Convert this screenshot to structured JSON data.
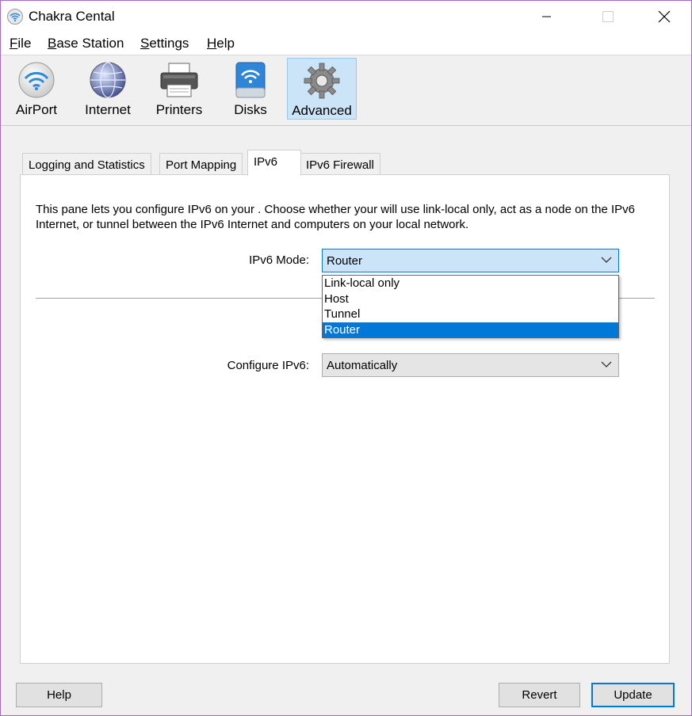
{
  "window": {
    "title": "Chakra Cental"
  },
  "menu": [
    {
      "mnemonic": "F",
      "rest": "ile"
    },
    {
      "mnemonic": "B",
      "rest": "ase Station"
    },
    {
      "mnemonic": "S",
      "rest": "ettings"
    },
    {
      "mnemonic": "H",
      "rest": "elp"
    }
  ],
  "toolbar": [
    {
      "label": "AirPort",
      "icon": "wifi-icon"
    },
    {
      "label": "Internet",
      "icon": "globe-icon"
    },
    {
      "label": "Printers",
      "icon": "printer-icon"
    },
    {
      "label": "Disks",
      "icon": "disk-icon"
    },
    {
      "label": "Advanced",
      "icon": "gear-icon",
      "selected": true
    }
  ],
  "tabs": [
    "Logging and Statistics",
    "Port Mapping",
    "IPv6",
    "IPv6 Firewall"
  ],
  "active_tab": "IPv6",
  "pane": {
    "description": "This pane lets you configure IPv6 on your . Choose whether your  will use link-local only, act as a node on the IPv6 Internet, or tunnel between the IPv6 Internet and computers on your local network.",
    "mode_label": "IPv6 Mode:",
    "mode_value": "Router",
    "mode_options": [
      "Link-local only",
      "Host",
      "Tunnel",
      "Router"
    ],
    "configure_label": "Configure IPv6:",
    "configure_value": "Automatically"
  },
  "buttons": {
    "help": "Help",
    "revert": "Revert",
    "update": "Update"
  },
  "colors": {
    "accent": "#0078d7",
    "selection_bg": "#cce4f7",
    "window_border": "#a267c9"
  }
}
